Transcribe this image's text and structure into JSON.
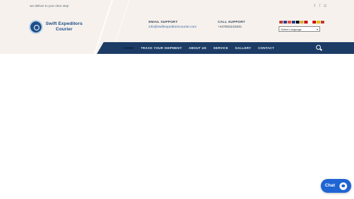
{
  "header": {
    "tagline": "we deliver to your door step",
    "social": [
      "twitter-icon",
      "facebook-icon",
      "instagram-icon"
    ],
    "logo": {
      "line1": "Swift Expeditors",
      "line2": "Courier"
    },
    "email_support": {
      "label": "EMAIL SUPPORT",
      "value": "info@swiftexpeditorscourier.com"
    },
    "call_support": {
      "label": "CALL SUPPORT",
      "value": "+447502218401"
    },
    "language": {
      "select_label": "Select Language",
      "flags": [
        "#c0392b",
        "#2c3e90",
        "#e74c3c",
        "#1f3f8f",
        "#000000",
        "#d4af37",
        "#cc0000",
        "#ffffff",
        "#cc0000",
        "#e6b800",
        "#c0392b"
      ]
    }
  },
  "nav": {
    "items": [
      {
        "label": "HOME",
        "active": true
      },
      {
        "label": "TRACK YOUR SHIPMENT"
      },
      {
        "label": "ABOUT US"
      },
      {
        "label": "SERVICE"
      },
      {
        "label": "GALLERY"
      },
      {
        "label": "CONTACT"
      }
    ]
  },
  "chat_widget": {
    "label": "Chat"
  },
  "colors": {
    "header_bg": "#f6f1ec",
    "nav_bg": "#1c3c66",
    "brand_blue": "#1f4f8a",
    "chat_blue": "#1e64d3"
  }
}
